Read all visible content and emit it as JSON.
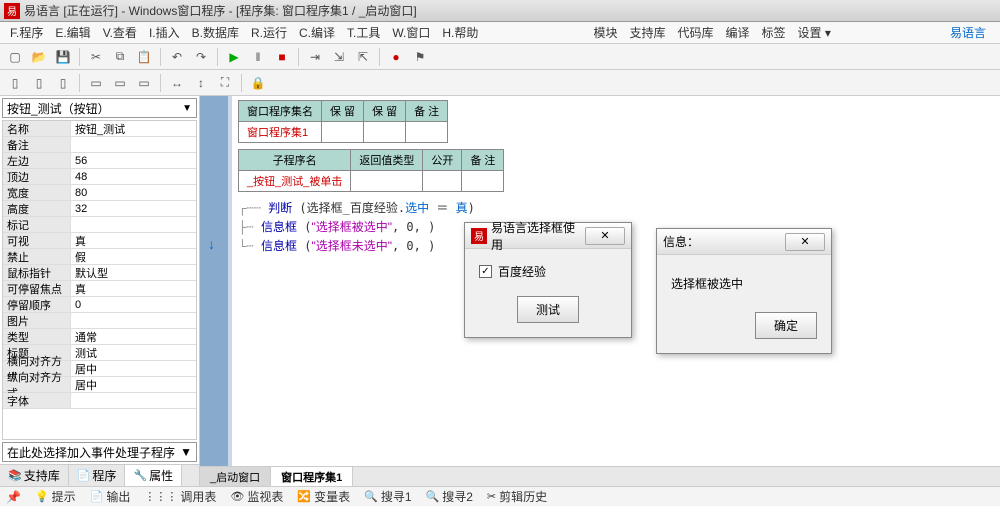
{
  "titlebar": {
    "app_icon": "易",
    "title": "易语言 [正在运行] - Windows窗口程序 - [程序集: 窗口程序集1 / _启动窗口]"
  },
  "menu": {
    "items": [
      "F.程序",
      "E.编辑",
      "V.查看",
      "I.插入",
      "B.数据库",
      "R.运行",
      "C.编译",
      "T.工具",
      "W.窗口",
      "H.帮助"
    ],
    "right_items": [
      "模块",
      "支持库",
      "代码库",
      "编译",
      "标签",
      "设置 ▾"
    ],
    "right_link": "易语言"
  },
  "properties": {
    "combo": "按钮_测试（按钮）",
    "rows": [
      {
        "name": "名称",
        "val": "按钮_测试"
      },
      {
        "name": "备注",
        "val": ""
      },
      {
        "name": "左边",
        "val": "56"
      },
      {
        "name": "顶边",
        "val": "48"
      },
      {
        "name": "宽度",
        "val": "80"
      },
      {
        "name": "高度",
        "val": "32"
      },
      {
        "name": "标记",
        "val": ""
      },
      {
        "name": "可视",
        "val": "真"
      },
      {
        "name": "禁止",
        "val": "假"
      },
      {
        "name": "鼠标指针",
        "val": "默认型"
      },
      {
        "name": "可停留焦点",
        "val": "真",
        "sel": true
      },
      {
        "name": "停留顺序",
        "val": "0"
      },
      {
        "name": "图片",
        "val": ""
      },
      {
        "name": "类型",
        "val": "通常"
      },
      {
        "name": "标题",
        "val": "测试"
      },
      {
        "name": "横向对齐方式",
        "val": "居中"
      },
      {
        "name": "纵向对齐方式",
        "val": "居中"
      },
      {
        "name": "字体",
        "val": ""
      }
    ],
    "hint": "在此处选择加入事件处理子程序",
    "tabs": [
      "支持库",
      "程序",
      "属性"
    ],
    "active_tab": 2
  },
  "code": {
    "table1": {
      "headers": [
        "窗口程序集名",
        "保 留",
        "保 留",
        "备 注"
      ],
      "row": [
        "窗口程序集1",
        "",
        "",
        ""
      ]
    },
    "table2": {
      "headers": [
        "子程序名",
        "返回值类型",
        "公开",
        "备 注"
      ],
      "row": [
        "_按钮_测试_被单击",
        "",
        "",
        ""
      ]
    },
    "lines": [
      {
        "tree": "┌┄┄",
        "kw": "判断",
        "txt1": " (选择框_百度经验.",
        "sel": "选中",
        "txt2": " ＝ ",
        "eq": "真",
        "txt3": ")"
      },
      {
        "tree": "├┄",
        "kw": "信息框",
        "txt1": " (",
        "str": "\"选择框被选中\"",
        "txt2": ", 0, )"
      },
      {
        "tree": "└┄",
        "kw": "信息框",
        "txt1": " (",
        "str": "\"选择框未选中\"",
        "txt2": ", 0, )"
      }
    ],
    "tabs": [
      {
        "label": "_启动窗口",
        "active": false
      },
      {
        "label": "窗口程序集1",
        "active": true
      }
    ]
  },
  "dialog1": {
    "title": "易语言选择框使用",
    "checkbox_label": "百度经验",
    "checked": true,
    "button": "测试"
  },
  "dialog2": {
    "title": "信息：",
    "message": "选择框被选中",
    "button": "确定"
  },
  "statusbar": {
    "items": [
      "提示",
      "输出",
      "调用表",
      "监视表",
      "变量表",
      "搜寻1",
      "搜寻2",
      "剪辑历史"
    ]
  }
}
